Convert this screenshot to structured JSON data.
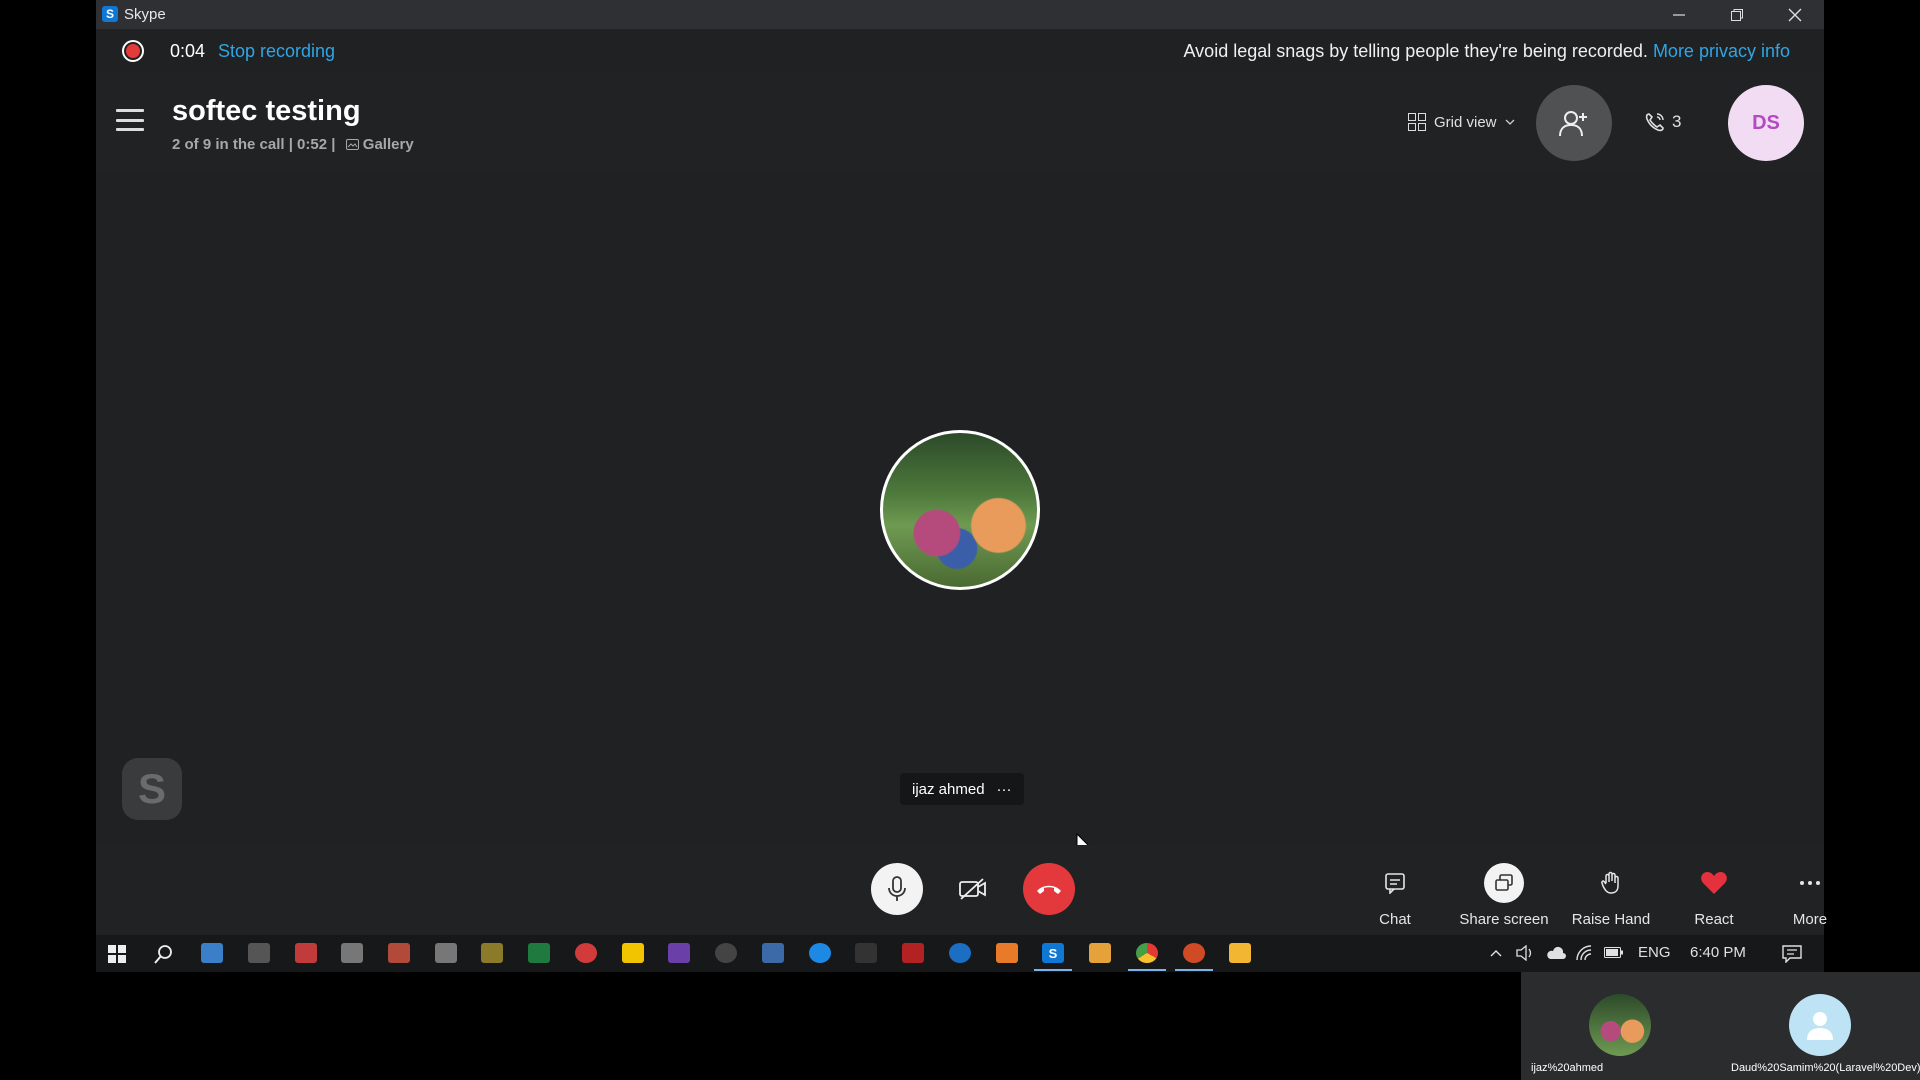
{
  "window": {
    "title": "Skype",
    "app_icon": "S",
    "buttons": {
      "minimize": "—",
      "restore": "❐",
      "close": "✕"
    }
  },
  "recording": {
    "elapsed": "0:04",
    "stop_label": "Stop recording",
    "notice": "Avoid legal snags by telling people they're being recorded.",
    "privacy_link": "More privacy info",
    "dot_color": "#e43a3a"
  },
  "header": {
    "call_title": "softec testing",
    "call_subtitle": "2 of 9 in the call | 0:52 |",
    "gallery_label": "Gallery",
    "grid_view_label": "Grid view",
    "participant_count": "3",
    "user_initials": "DS"
  },
  "stage": {
    "participant_name": "ijaz ahmed",
    "name_menu": "···",
    "watermark": "S"
  },
  "controls": {
    "chat_label": "Chat",
    "share_label": "Share screen",
    "raise_label": "Raise Hand",
    "react_label": "React",
    "more_label": "More",
    "hangup_color": "#e4393c"
  },
  "taskbar": {
    "language": "ENG",
    "time": "6:40 PM",
    "skype_letter": "S"
  },
  "thumbnails": [
    {
      "name": "ijaz%20ahmed"
    },
    {
      "name": "Daud%20Samim%20(Laravel%20Dev)"
    }
  ],
  "colors": {
    "accent_link": "#2fa5e6",
    "react_heart": "#e5303d",
    "avatar_text": "#b44ac2"
  }
}
